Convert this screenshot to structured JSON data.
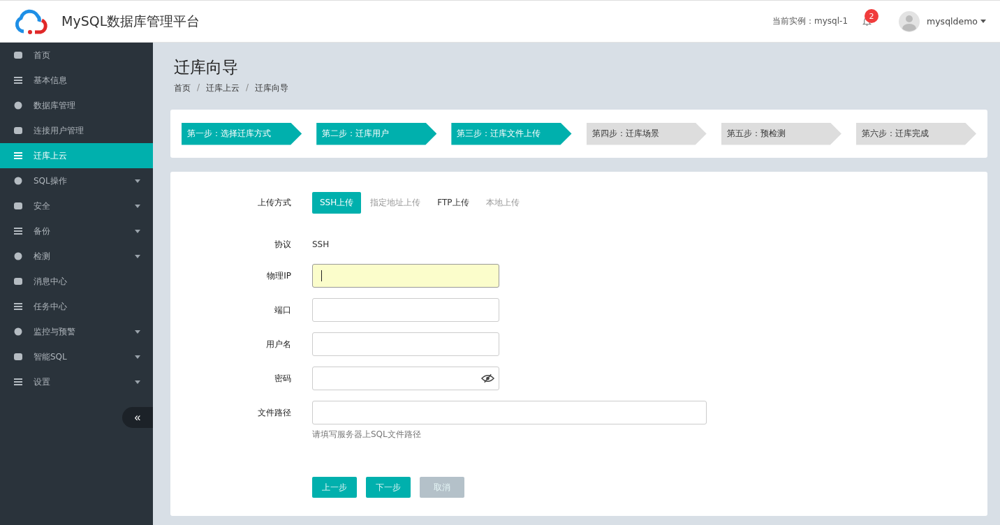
{
  "header": {
    "title": "MySQL数据库管理平台",
    "instance_label": "当前实例：mysql-1",
    "notification_count": "2",
    "user": "mysqldemo"
  },
  "sidebar": {
    "items": [
      {
        "label": "首页",
        "selected": false,
        "has_submenu": false
      },
      {
        "label": "基本信息",
        "selected": false,
        "has_submenu": false
      },
      {
        "label": "数据库管理",
        "selected": false,
        "has_submenu": false
      },
      {
        "label": "连接用户管理",
        "selected": false,
        "has_submenu": false
      },
      {
        "label": "迁库上云",
        "selected": true,
        "has_submenu": false
      },
      {
        "label": "SQL操作",
        "selected": false,
        "has_submenu": true
      },
      {
        "label": "安全",
        "selected": false,
        "has_submenu": true
      },
      {
        "label": "备份",
        "selected": false,
        "has_submenu": true
      },
      {
        "label": "检测",
        "selected": false,
        "has_submenu": true
      },
      {
        "label": "消息中心",
        "selected": false,
        "has_submenu": false
      },
      {
        "label": "任务中心",
        "selected": false,
        "has_submenu": false
      },
      {
        "label": "监控与预警",
        "selected": false,
        "has_submenu": true
      },
      {
        "label": "智能SQL",
        "selected": false,
        "has_submenu": true
      },
      {
        "label": "设置",
        "selected": false,
        "has_submenu": true
      }
    ],
    "collapse": "«"
  },
  "page": {
    "title": "迁库向导",
    "breadcrumbs": [
      "首页",
      "迁库上云",
      "迁库向导"
    ],
    "breadcrumb_separator": "/"
  },
  "steps": [
    {
      "label": "第一步：选择迁库方式",
      "done": true
    },
    {
      "label": "第二步：迁库用户",
      "done": true
    },
    {
      "label": "第三步：迁库文件上传",
      "done": true
    },
    {
      "label": "第四步：迁库场景",
      "done": false
    },
    {
      "label": "第五步：预检测",
      "done": false
    },
    {
      "label": "第六步：迁库完成",
      "done": false
    }
  ],
  "form": {
    "upload_label": "上传方式",
    "upload_methods": [
      {
        "label": "SSH上传",
        "selected": true,
        "disabled": false
      },
      {
        "label": "指定地址上传",
        "selected": false,
        "disabled": true
      },
      {
        "label": "FTP上传",
        "selected": false,
        "disabled": false
      },
      {
        "label": "本地上传",
        "selected": false,
        "disabled": true
      }
    ],
    "protocol": {
      "label": "协议",
      "value": "SSH"
    },
    "fields": [
      {
        "label": "物理IP",
        "kind": "text",
        "focused": true,
        "wide": false
      },
      {
        "label": "端口",
        "kind": "text",
        "focused": false,
        "wide": false
      },
      {
        "label": "用户名",
        "kind": "text",
        "focused": false,
        "wide": false
      },
      {
        "label": "密码",
        "kind": "password",
        "focused": false,
        "wide": false
      },
      {
        "label": "文件路径",
        "kind": "text",
        "focused": false,
        "wide": true,
        "hint": "请填写服务器上SQL文件路径"
      }
    ],
    "buttons": [
      {
        "label": "上一步",
        "disabled": false
      },
      {
        "label": "下一步",
        "disabled": false
      },
      {
        "label": "取消",
        "disabled": true
      }
    ]
  }
}
